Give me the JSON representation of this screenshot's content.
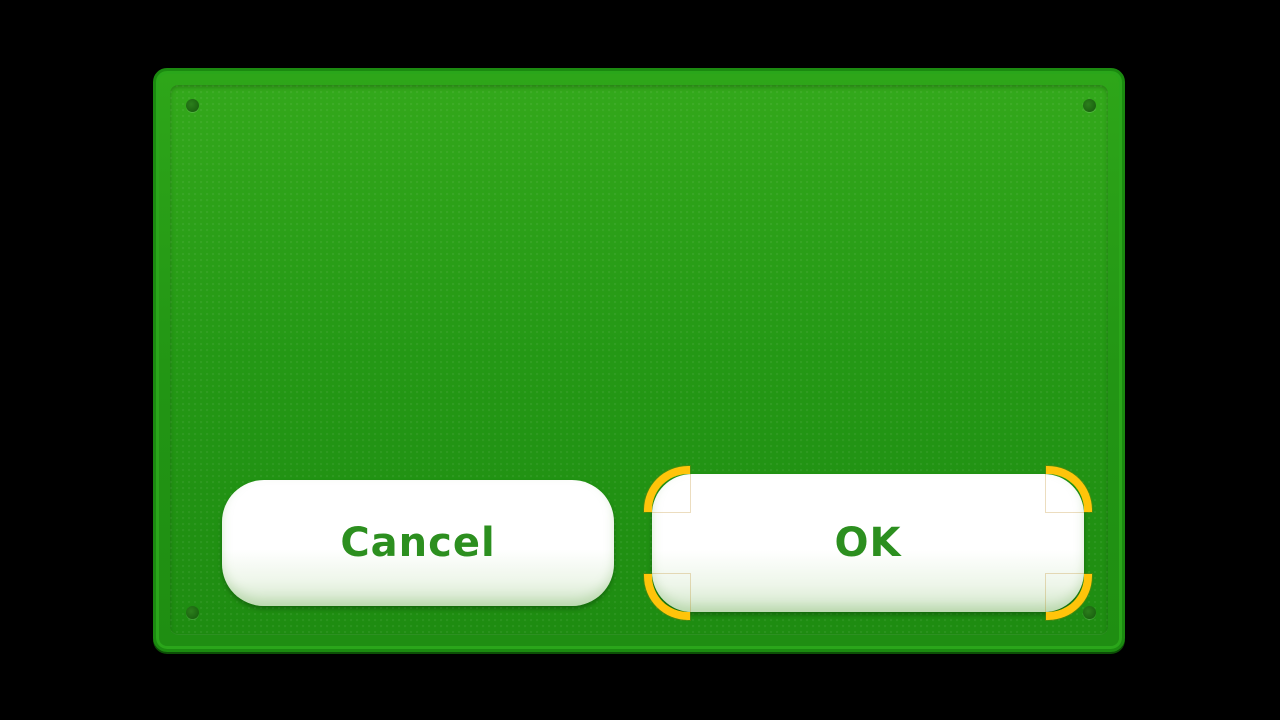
{
  "dialog": {
    "cancel_label": "Cancel",
    "ok_label": "OK",
    "focused_button": "ok"
  },
  "colors": {
    "panel_green": "#249815",
    "label_green": "#2c8f1f",
    "focus_yellow": "#ffc40a",
    "background": "#000000"
  }
}
